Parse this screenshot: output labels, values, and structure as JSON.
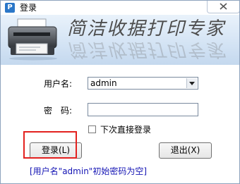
{
  "window": {
    "icon_letter": "P",
    "title": "登录"
  },
  "banner": {
    "brand": "简洁收据打印专家"
  },
  "form": {
    "username_label": "用户名:",
    "username_value": "admin",
    "password_label": "密　码:",
    "password_value": "",
    "remember_label": "下次直接登录",
    "remember_checked": false
  },
  "buttons": {
    "login_label": "登录(L)",
    "exit_label": "退出(X)"
  },
  "hint": "[用户名\"admin\"初始密码为空]",
  "colors": {
    "banner": "#d3e3f4",
    "hint": "#1414b4",
    "highlight": "#e3211f"
  },
  "icons": [
    "app-icon",
    "close-icon",
    "printer-icon",
    "dropdown-arrow-icon"
  ]
}
